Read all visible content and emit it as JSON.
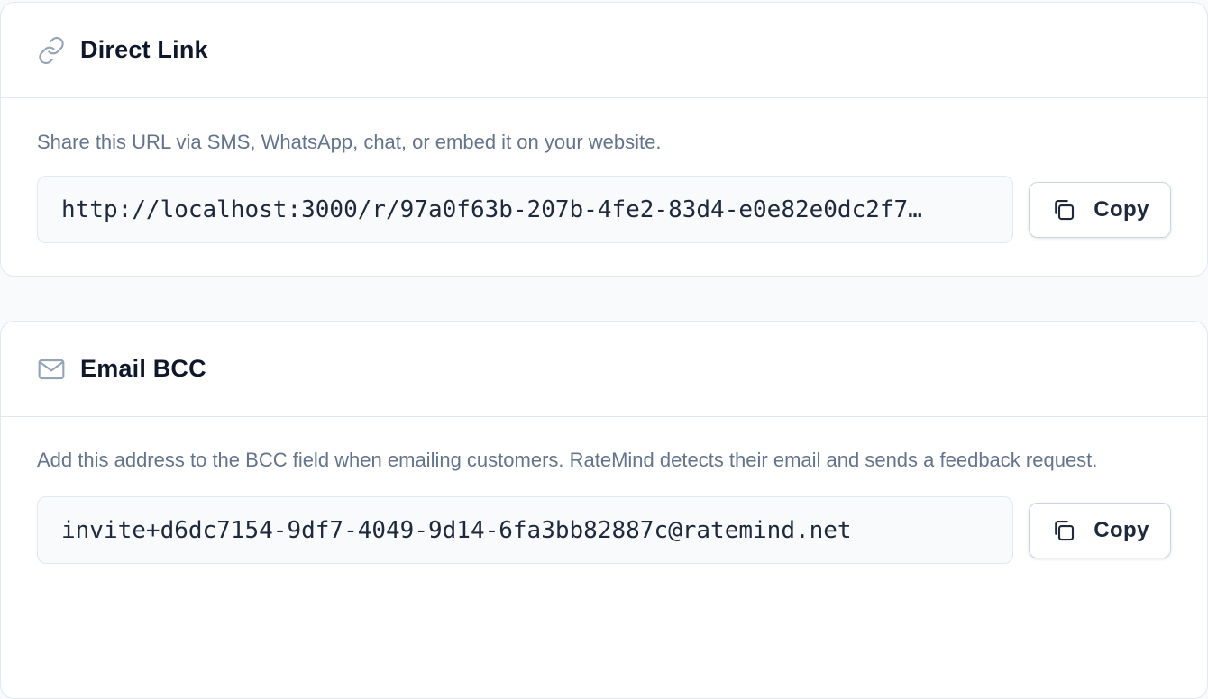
{
  "direct_link": {
    "title": "Direct Link",
    "icon": "link-icon",
    "description": "Share this URL via SMS, WhatsApp, chat, or embed it on your website.",
    "url": "http://localhost:3000/r/97a0f63b-207b-4fe2-83d4-e0e82e0dc2f7…",
    "copy_label": "Copy"
  },
  "email_bcc": {
    "title": "Email BCC",
    "icon": "mail-icon",
    "description": "Add this address to the BCC field when emailing customers. RateMind detects their email and sends a feedback request.",
    "address": "invite+d6dc7154-9df7-4049-9d14-6fa3bb82887c@ratemind.net",
    "copy_label": "Copy"
  },
  "colors": {
    "page_bg": "#f8fafc",
    "card_bg": "#ffffff",
    "border": "#e2e8f0",
    "muted_text": "#64748b",
    "icon_color": "#94a3b8",
    "title_text": "#0f172a"
  }
}
